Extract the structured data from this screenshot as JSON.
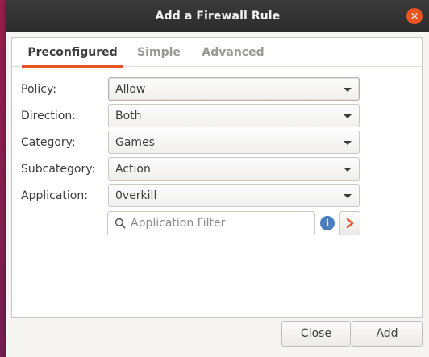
{
  "window": {
    "title": "Add a Firewall Rule",
    "close_icon": "close-icon"
  },
  "tabs": [
    {
      "label": "Preconfigured",
      "active": true
    },
    {
      "label": "Simple",
      "active": false
    },
    {
      "label": "Advanced",
      "active": false
    }
  ],
  "form": {
    "policy": {
      "label": "Policy:",
      "value": "Allow"
    },
    "direction": {
      "label": "Direction:",
      "value": "Both"
    },
    "category": {
      "label": "Category:",
      "value": "Games"
    },
    "subcategory": {
      "label": "Subcategory:",
      "value": "Action"
    },
    "application": {
      "label": "Application:",
      "value": "0verkill"
    }
  },
  "filter": {
    "placeholder": "Application Filter",
    "value": ""
  },
  "info_icon": {
    "glyph": "i"
  },
  "buttons": {
    "close": "Close",
    "add": "Add"
  },
  "colors": {
    "accent": "#e95420",
    "titlebar": "#2c2c2c",
    "info": "#4a7cc2"
  }
}
